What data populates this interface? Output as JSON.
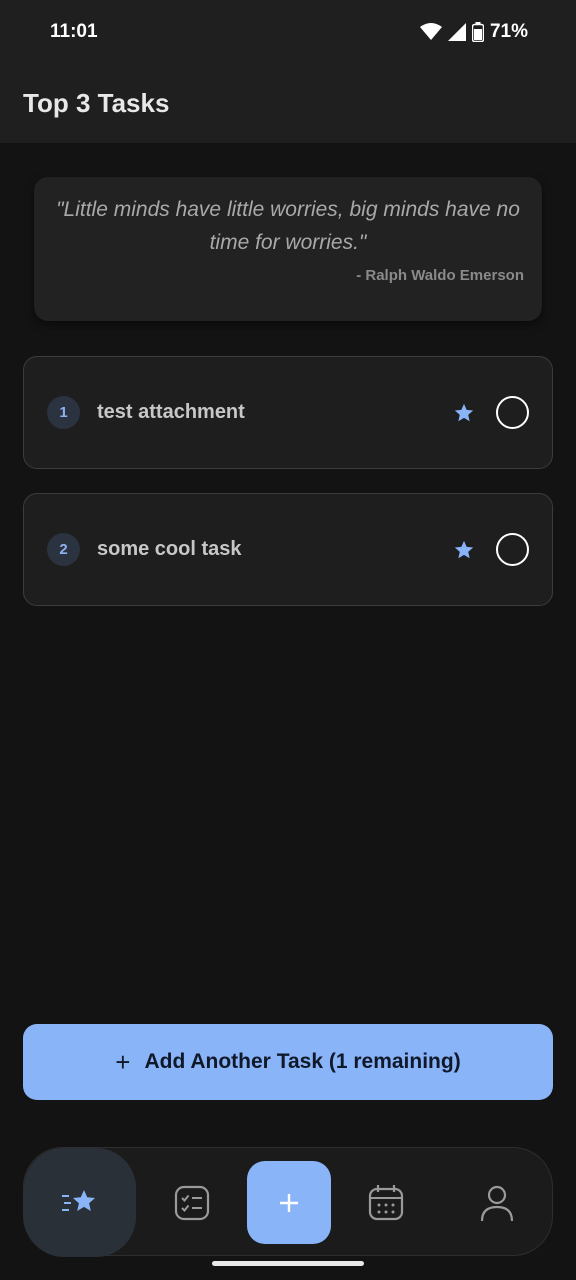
{
  "status_bar": {
    "time": "11:01",
    "battery": "71%"
  },
  "app_bar": {
    "title": "Top 3 Tasks"
  },
  "quote": {
    "text": "\"Little minds have little worries, big minds have no time for worries.\"",
    "author": "- Ralph Waldo Emerson"
  },
  "tasks": [
    {
      "number": "1",
      "title": "test attachment",
      "starred": true,
      "completed": false
    },
    {
      "number": "2",
      "title": "some cool task",
      "starred": true,
      "completed": false
    }
  ],
  "add_button": {
    "label": "Add Another Task (1 remaining)"
  },
  "bottom_nav": {
    "items": [
      {
        "icon": "top-tasks-star-icon",
        "active": true
      },
      {
        "icon": "checklist-icon",
        "active": false
      },
      {
        "icon": "plus-icon",
        "active": false
      },
      {
        "icon": "calendar-icon",
        "active": false
      },
      {
        "icon": "profile-icon",
        "active": false
      }
    ]
  },
  "colors": {
    "accent": "#8ab4f8",
    "background": "#131313",
    "surface": "#1f1f1f"
  }
}
